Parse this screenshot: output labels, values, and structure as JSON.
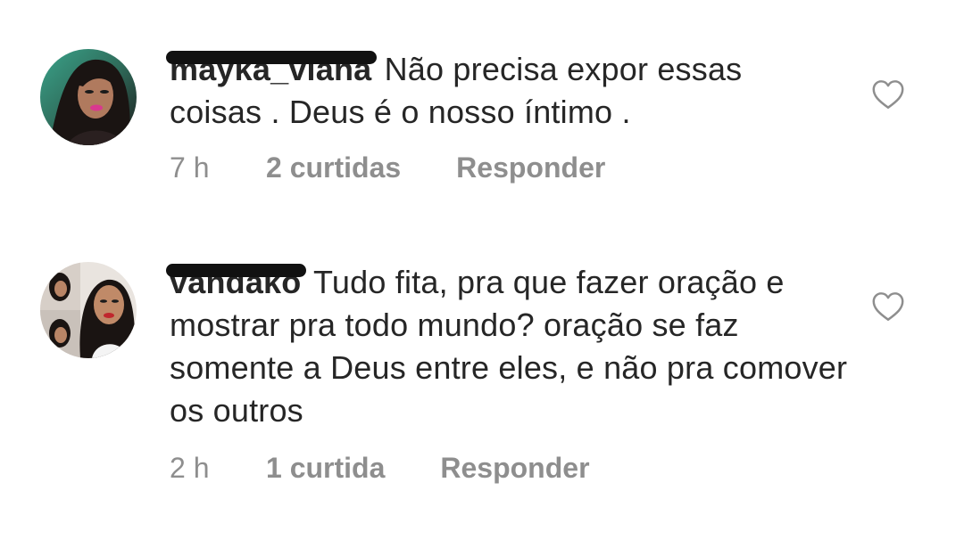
{
  "comments": [
    {
      "username": "mayka_viana",
      "text": "Não precisa expor essas coisas . Deus é o nosso íntimo .",
      "time": "7 h",
      "likes": "2 curtidas",
      "reply": "Responder"
    },
    {
      "username": "vandako",
      "text": "Tudo fita, pra que fazer oração e mostrar pra todo mundo? oração se faz somente a Deus entre eles, e não pra comover os outros",
      "time": "2 h",
      "likes": "1 curtida",
      "reply": "Responder"
    }
  ],
  "icons": {
    "like": "heart-outline-icon"
  },
  "colors": {
    "text": "#262626",
    "meta": "#8e8e8e",
    "icon": "#8e8e8e"
  }
}
